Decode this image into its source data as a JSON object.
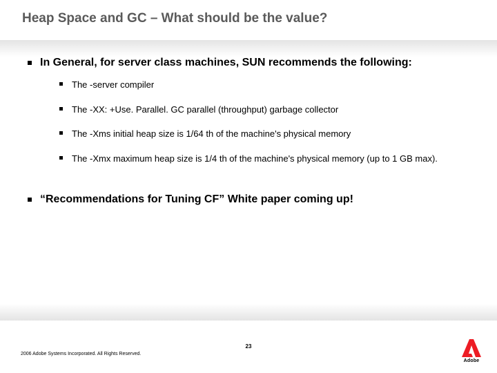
{
  "title": "Heap Space and GC – What should be the value?",
  "points": {
    "p1": "In General, for server class machines, SUN recommends the following:",
    "sub1": "The -server compiler",
    "sub2": "The -XX: +Use. Parallel. GC parallel (throughput) garbage collector",
    "sub3": "The -Xms initial heap size is 1/64 th of the machine's physical memory",
    "sub4": "The -Xmx maximum heap size is 1/4 th of the machine's physical memory (up to 1 GB max).",
    "p2": "“Recommendations for Tuning CF” White paper coming up!"
  },
  "footer": {
    "copyright": "2006 Adobe Systems Incorporated. All Rights Reserved.",
    "page": "23",
    "logo_text": "Adobe"
  }
}
